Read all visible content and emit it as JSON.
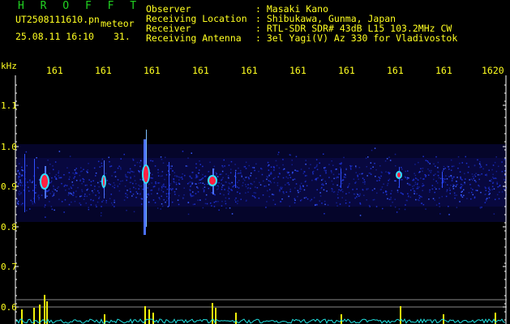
{
  "header": {
    "title": "H R O F F T",
    "filename": "UT2508111610.pn",
    "meteor_label": "meteor",
    "timestamp": "25.08.11 16:10",
    "count": "31."
  },
  "info": [
    {
      "label": "Observer",
      "value": ": Masaki Kano"
    },
    {
      "label": "Receiving Location",
      "value": ": Shibukawa, Gunma, Japan"
    },
    {
      "label": "Receiver",
      "value": ": RTL-SDR SDR# 43dB L15 103.2MHz CW"
    },
    {
      "label": "Receiving Antenna",
      "value": ": 3el Yagi(V) Az 330 for Vladivostok"
    }
  ],
  "time_axis": [
    "161",
    "161",
    "161",
    "161",
    "161",
    "161",
    "161",
    "161",
    "161",
    "1620"
  ],
  "freq_axis": {
    "unit": "kHz",
    "labels": [
      "1.1",
      "1.0",
      "0.9",
      "0.8",
      "0.7",
      "0.6"
    ]
  },
  "colors": {
    "title_green": "#21d321",
    "text_yellow": "#ffff20",
    "noise_blue": "#1a2cc8",
    "signal_red": "#ff2040",
    "baseline_cyan": "#20e0e0",
    "peak_yellow": "#f2f20a"
  }
}
